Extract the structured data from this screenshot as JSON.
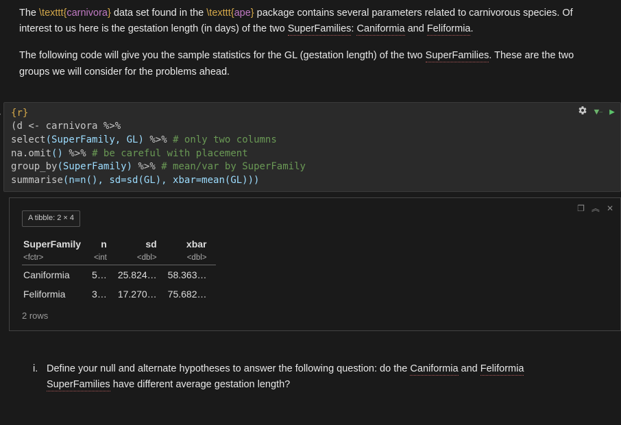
{
  "intro": {
    "p1a": "The ",
    "latex1_cmd": "\\texttt",
    "latex1_arg": "carnivora",
    "p1b": " data set found in the ",
    "latex2_cmd": "\\texttt",
    "latex2_arg": "ape",
    "p1c": " package contains several parameters related to carnivorous species. Of interest to us here is the gestation length (in days) of the two ",
    "super1": "SuperFamilies",
    "p1d": ": ",
    "can1": "Caniformia",
    "p1e": " and ",
    "fel1": "Feliformia",
    "p1f": ".",
    "p2a": "The following code will give you the sample statistics for the GL (gestation length) of the two ",
    "super2": "SuperFamilies",
    "p2b": ". These are the two groups we will consider for the problems ahead."
  },
  "code": {
    "chunk_tag_open": "{",
    "chunk_tag": "r",
    "chunk_tag_close": "}",
    "l1": "(d <- carnivora %>%",
    "l2a": "select",
    "l2b": "(SuperFamily, GL)",
    "l2pipe": " %>% ",
    "l2c": "# only two columns",
    "l3a": "na.omit",
    "l3b": "()",
    "l3pipe": " %>% ",
    "l3c": "# be careful with placement",
    "l4a": "group_by",
    "l4b": "(SuperFamily)",
    "l4pipe": " %>% ",
    "l4c": "# mean/var by SuperFamily",
    "l5a": "summarise",
    "l5b": "(n=n(), sd=sd(GL), xbar=mean(GL)))"
  },
  "toolbar": {
    "gear_title": "Settings",
    "down_title": "Run Above",
    "play_title": "Run Chunk"
  },
  "output": {
    "tibble_label": "A tibble: 2 × 4",
    "headers": {
      "c1": "SuperFamily",
      "c1t": "<fctr>",
      "c2": "n",
      "c2t": "<int",
      "c3": "sd",
      "c3t": "<dbl>",
      "c4": "xbar",
      "c4t": "<dbl>"
    },
    "rows": [
      {
        "c1": "Caniformia",
        "c2": "5…",
        "c3": "25.824…",
        "c4": "58.363…"
      },
      {
        "c1": "Feliformia",
        "c2": "3…",
        "c3": "17.270…",
        "c4": "75.682…"
      }
    ],
    "row_count": "2 rows"
  },
  "question": {
    "marker": "i.",
    "q1a": "Define your null and alternate hypotheses to answer the following question: do the ",
    "can2": "Caniformia",
    "q1b": " and ",
    "fel2": "Feliformia",
    "super3": "SuperFamilies",
    "q1c": " have different average gestation length?"
  }
}
